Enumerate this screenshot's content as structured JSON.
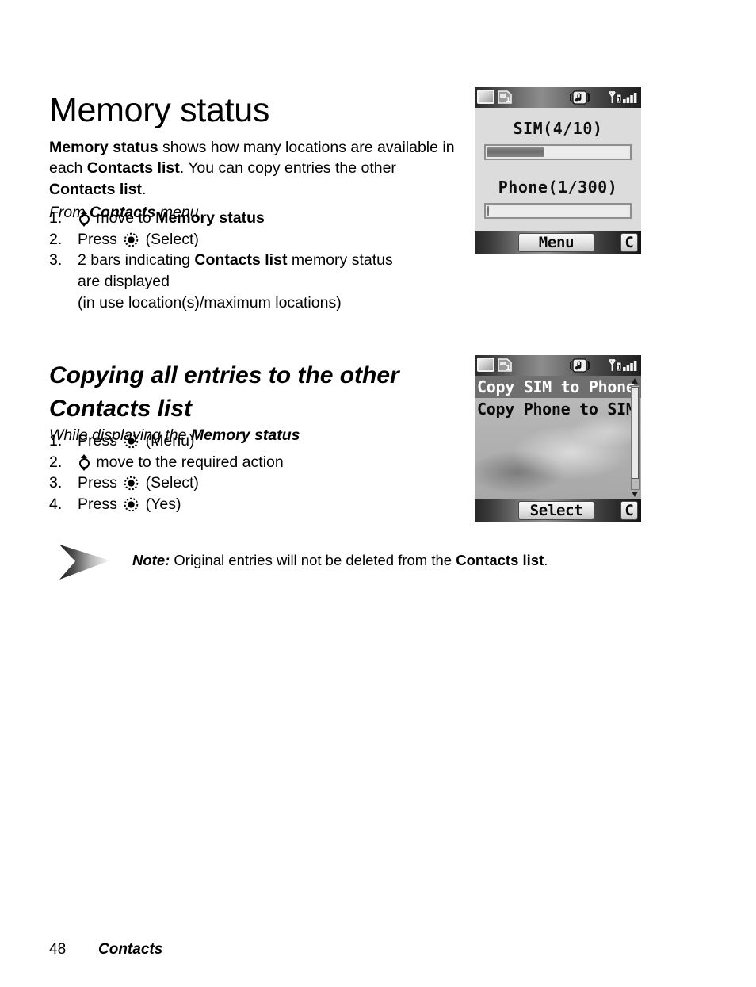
{
  "page_title": "Memory status",
  "intro": {
    "seg1": "Memory status",
    "seg2": " shows how many locations are available in each ",
    "seg3": "Contacts list",
    "seg4": ". You can copy entries the other ",
    "seg5": "Contacts list",
    "seg6": "."
  },
  "from_menu": {
    "pre": "From ",
    "bold": "Contacts",
    "post": " menu"
  },
  "steps_memory": [
    {
      "num": "1.",
      "icon": "nav-key-icon",
      "pre": " move to ",
      "bold": "Memory status",
      "post": ""
    },
    {
      "num": "2.",
      "icon": "select-key-icon",
      "pre_icon": "Press ",
      "post": " (Select)"
    },
    {
      "num": "3.",
      "pre": "2 bars indicating ",
      "bold": "Contacts list",
      "post": " memory status",
      "line2": "are displayed",
      "line3": "(in use location(s)/maximum locations)"
    }
  ],
  "section_heading": "Copying all entries to the other Contacts list",
  "while_displaying": {
    "pre": "While displaying the ",
    "bold": "Memory status"
  },
  "steps_copy": [
    {
      "num": "1.",
      "pre_icon": "Press ",
      "icon": "select-key-icon",
      "post": " (Menu)"
    },
    {
      "num": "2.",
      "icon": "nav-key-icon",
      "post": " move to the required action"
    },
    {
      "num": "3.",
      "pre_icon": "Press ",
      "icon": "select-key-icon",
      "post": " (Select)"
    },
    {
      "num": "4.",
      "pre_icon": "Press ",
      "icon": "select-key-icon",
      "post": " (Yes)"
    }
  ],
  "note": {
    "label": "Note:",
    "text_pre": " Original entries will not be deleted from the ",
    "text_bold": "Contacts list",
    "text_post": "."
  },
  "footer": {
    "page_number": "48",
    "section": "Contacts"
  },
  "phone_memory": {
    "status_icons": [
      "battery-icon",
      "sim-card-icon",
      "melody-icon",
      "signal-strength-icon"
    ],
    "sim_label": "SIM(4/10)",
    "sim_used": 4,
    "sim_total": 10,
    "sim_percent": 40,
    "phone_label": "Phone(1/300)",
    "phone_used": 1,
    "phone_total": 300,
    "phone_percent": 0,
    "softkey_center": "Menu",
    "softkey_right": "C"
  },
  "phone_copy": {
    "status_icons": [
      "battery-icon",
      "sim-card-icon",
      "melody-icon",
      "signal-strength-icon"
    ],
    "menu_items": [
      {
        "label": "Copy SIM to Phone",
        "selected": true
      },
      {
        "label": "Copy Phone to SIM",
        "selected": false
      }
    ],
    "softkey_center": "Select",
    "softkey_right": "C"
  },
  "colors": {
    "page_background": "#ffffff",
    "text": "#000000",
    "screen_background": "#dcdcdc",
    "menu_background": "#b2b2b2",
    "highlight": "#6f6f6f",
    "highlight_text": "#ffffff",
    "status_bar_dark": "#2a2a2a",
    "softkey_face": "#e2e2e2"
  }
}
